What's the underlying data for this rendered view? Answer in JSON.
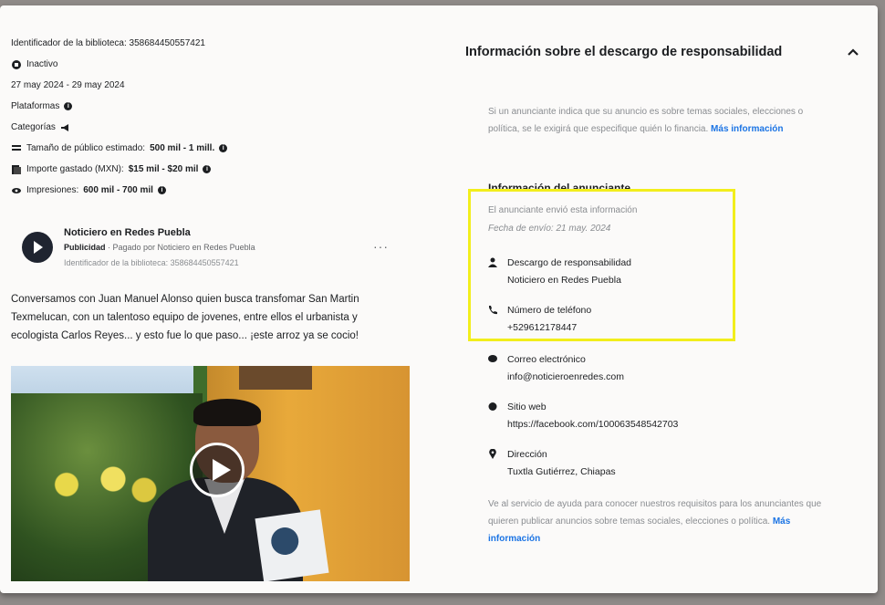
{
  "meta": {
    "library_id": "Identificador de la biblioteca: 358684450557421",
    "status": "Inactivo",
    "dates": "27 may 2024 - 29 may 2024",
    "platforms_label": "Plataformas",
    "categories_label": "Categorías",
    "audience_label": "Tamaño de público estimado:",
    "audience_value": "500 mil - 1 mill.",
    "spend_label": "Importe gastado (MXN):",
    "spend_value": "$15 mil - $20 mil",
    "impressions_label": "Impresiones:",
    "impressions_value": "600 mil - 700 mil"
  },
  "post": {
    "page_name": "Noticiero en Redes Puebla",
    "sponsored": "Publicidad",
    "paid_by": " · Pagado por Noticiero en Redes Puebla",
    "library_id": "Identificador de la biblioteca: 358684450557421",
    "text": "Conversamos con Juan Manuel Alonso quien busca transfomar San Martin Texmelucan, con un talentoso equipo de jovenes, entre ellos el urbanista y ecologista Carlos Reyes... y esto fue lo que paso... ¡este arroz ya se cocio!"
  },
  "disclaimer": {
    "title": "Información sobre el descargo de responsabilidad",
    "intro": "Si un anunciante indica que su anuncio es sobre temas sociales, elecciones o política, se le exigirá que especifique quién lo financia. ",
    "intro_link": "Más información",
    "advertiser_heading": "Información del anunciante",
    "sent_text": "El anunciante envió esta información",
    "sent_date": "Fecha de envío: 21 may. 2024",
    "items": [
      {
        "label": "Descargo de responsabilidad",
        "value": "Noticiero en Redes Puebla"
      },
      {
        "label": "Número de teléfono",
        "value": "+529612178447"
      },
      {
        "label": "Correo electrónico",
        "value": "info@noticieroenredes.com"
      },
      {
        "label": "Sitio web",
        "value": "https://facebook.com/100063548542703"
      },
      {
        "label": "Dirección",
        "value": "Tuxtla Gutiérrez, Chiapas"
      }
    ],
    "footer": "Ve al servicio de ayuda para conocer nuestros requisitos para los anunciantes que quieren publicar anuncios sobre temas sociales, elecciones o política. ",
    "footer_link": "Más información"
  },
  "colors": {
    "link": "#1b74e4",
    "highlight": "#f2ee1c"
  }
}
